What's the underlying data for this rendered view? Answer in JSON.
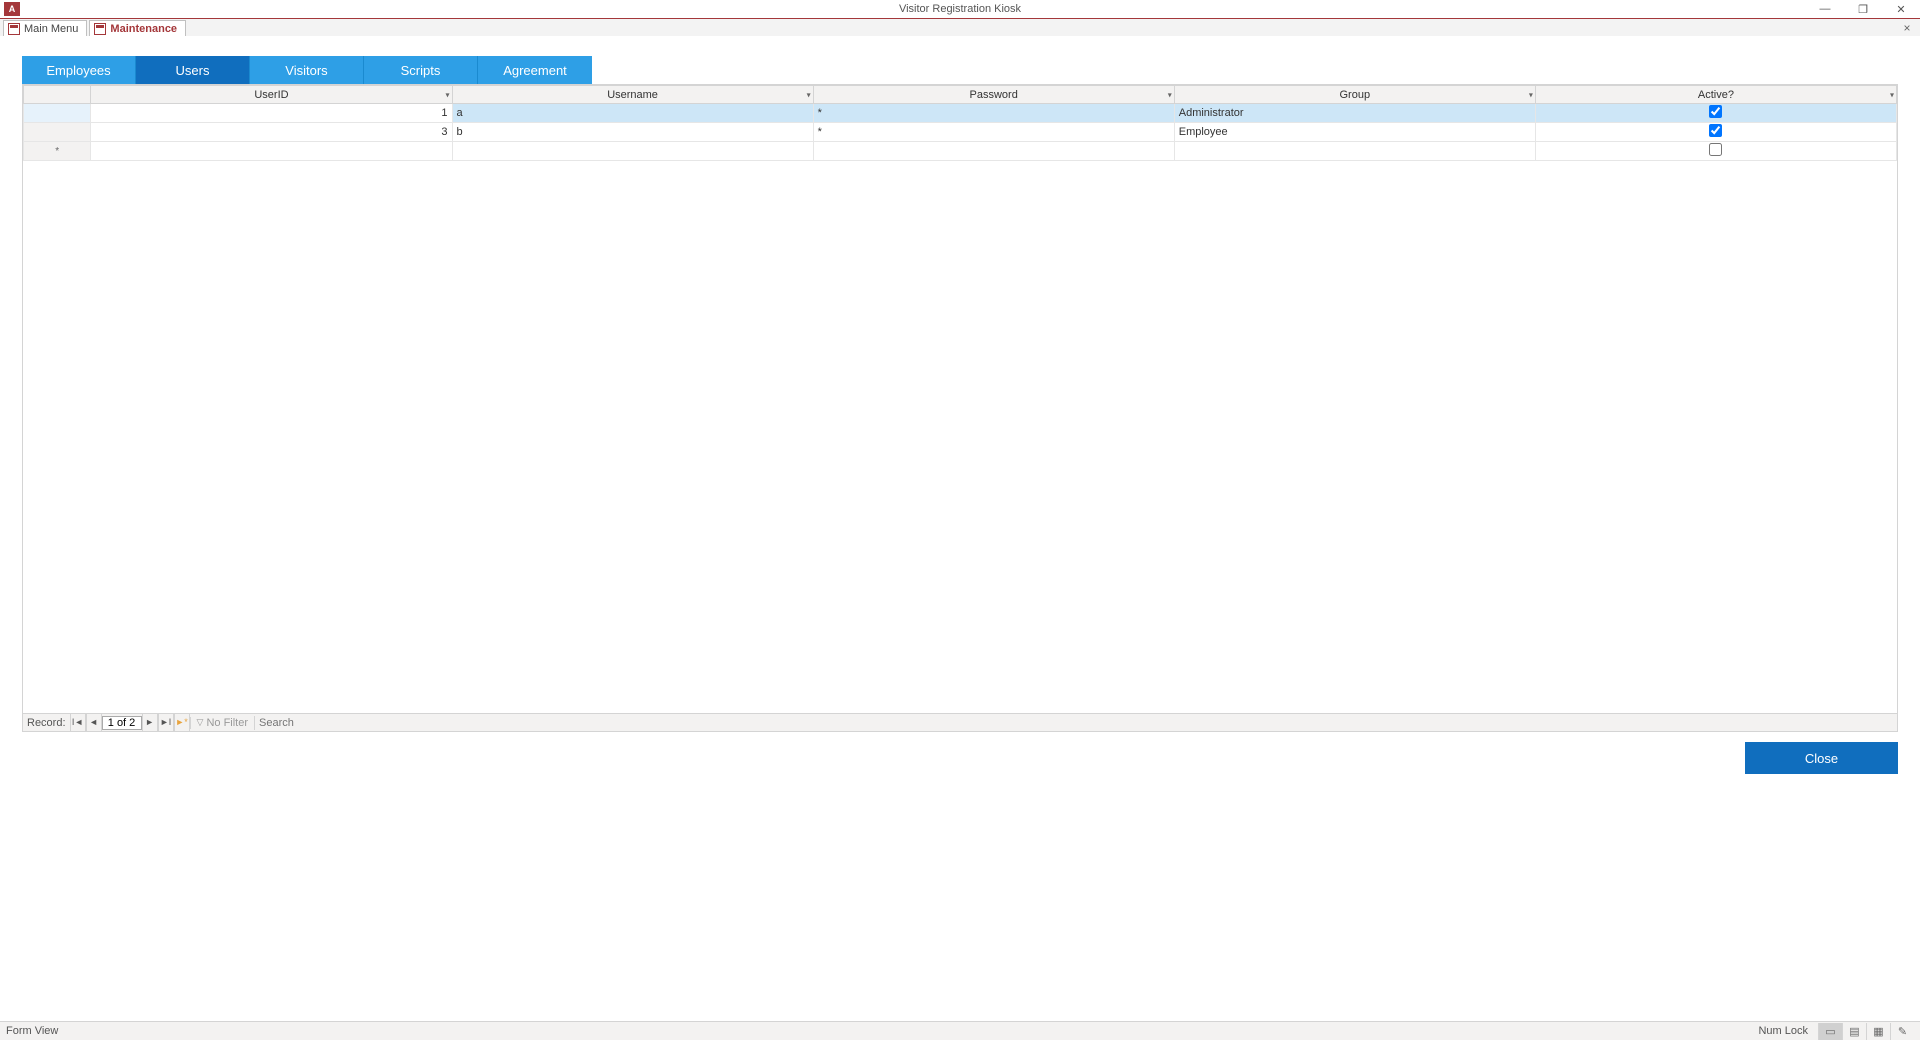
{
  "titlebar": {
    "app_icon_text": "A",
    "title": "Visitor Registration Kiosk",
    "minimize": "—",
    "maximize": "❐",
    "close": "✕"
  },
  "doc_tabs": {
    "items": [
      {
        "label": "Main Menu"
      },
      {
        "label": "Maintenance"
      }
    ],
    "close_glyph": "×"
  },
  "inner_tabs": {
    "items": [
      {
        "label": "Employees"
      },
      {
        "label": "Users"
      },
      {
        "label": "Visitors"
      },
      {
        "label": "Scripts"
      },
      {
        "label": "Agreement"
      }
    ]
  },
  "grid": {
    "columns": [
      "UserID",
      "Username",
      "Password",
      "Group",
      "Active?"
    ],
    "rows": [
      {
        "userid": "1",
        "username": "a",
        "password": "*",
        "group": "Administrator",
        "active": true
      },
      {
        "userid": "3",
        "username": "b",
        "password": "*",
        "group": "Employee",
        "active": true
      }
    ],
    "new_row_marker": "*"
  },
  "rec_nav": {
    "label": "Record:",
    "first": "I◄",
    "prev": "◄",
    "position": "1 of 2",
    "next": "►",
    "last": "►I",
    "new": "►*",
    "no_filter": "No Filter",
    "search_placeholder": "Search"
  },
  "buttons": {
    "close": "Close"
  },
  "statusbar": {
    "left": "Form View",
    "numlock": "Num Lock"
  }
}
